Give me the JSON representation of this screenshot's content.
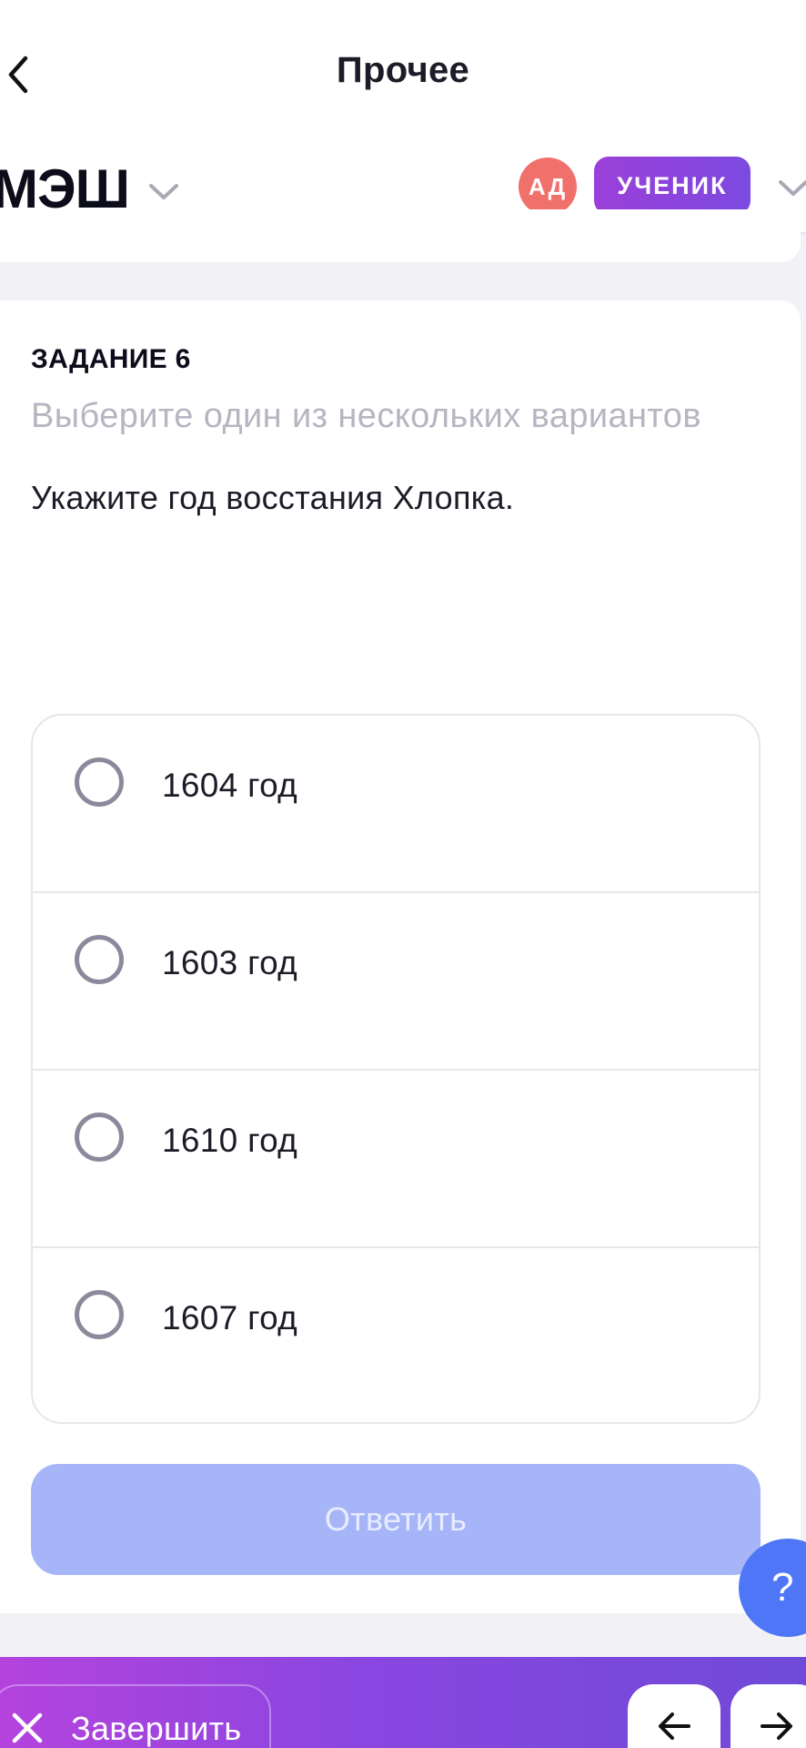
{
  "topbar": {
    "title": "Прочее",
    "back_icon": "chevron-left-icon"
  },
  "app_header": {
    "logo": "МЭШ",
    "avatar_initials": "АД",
    "role": "УЧЕНИК",
    "colors": {
      "avatar": "#f0706c",
      "role_badge": "#8a45dd"
    }
  },
  "task": {
    "number_label": "ЗАДАНИЕ 6",
    "hint": "Выберите один из нескольких вариантов",
    "question": "Укажите год восстания Хлопка.",
    "options": [
      {
        "label": "1604 год",
        "selected": false
      },
      {
        "label": "1603 год",
        "selected": false
      },
      {
        "label": "1610 год",
        "selected": false
      },
      {
        "label": "1607 год",
        "selected": false
      }
    ],
    "submit_label": "Ответить",
    "submit_enabled": false
  },
  "help": {
    "label": "?"
  },
  "bottom_bar": {
    "finish_label": "Завершить",
    "prev_icon": "arrow-left-icon",
    "next_icon": "arrow-right-icon"
  }
}
